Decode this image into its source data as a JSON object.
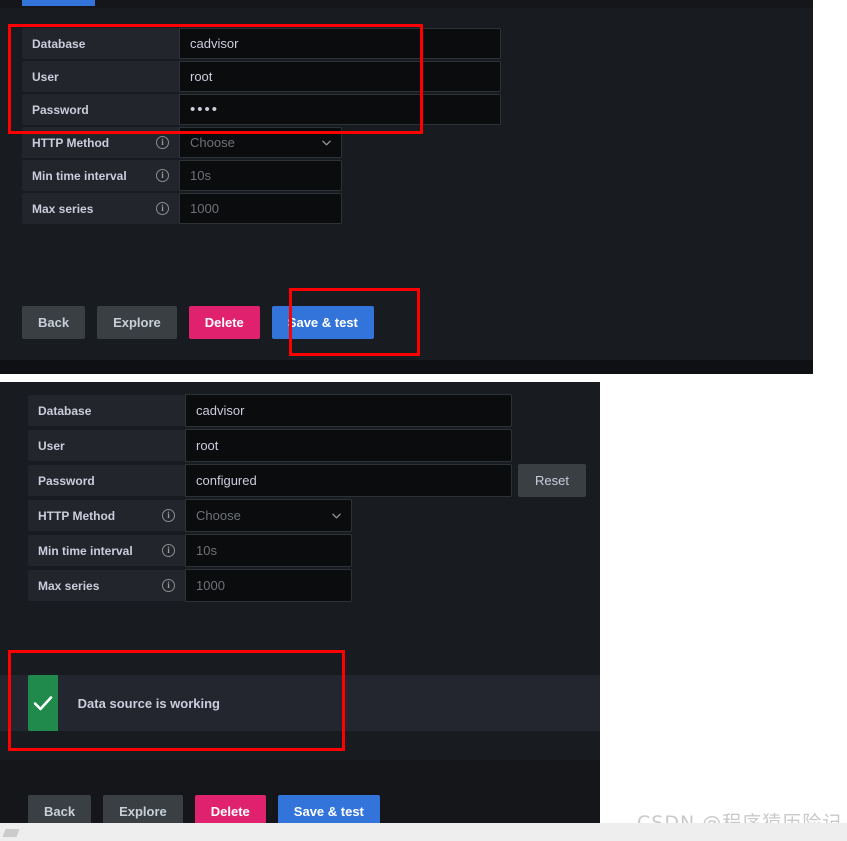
{
  "watermark": {
    "text": "CSDN @程序猿历险记"
  },
  "panel_top": {
    "tab": {
      "name": "active-tab-indicator"
    },
    "fields": [
      {
        "label": "Database",
        "value": "cadvisor",
        "placeholder": "",
        "type": "text",
        "has_info": false
      },
      {
        "label": "User",
        "value": "root",
        "placeholder": "",
        "type": "text",
        "has_info": false
      },
      {
        "label": "Password",
        "value": "••••",
        "placeholder": "",
        "type": "password",
        "has_info": false
      },
      {
        "label": "HTTP Method",
        "value": "",
        "placeholder": "Choose",
        "type": "select",
        "has_info": true
      },
      {
        "label": "Min time interval",
        "value": "",
        "placeholder": "10s",
        "type": "text",
        "has_info": true
      },
      {
        "label": "Max series",
        "value": "",
        "placeholder": "1000",
        "type": "text",
        "has_info": true
      }
    ],
    "buttons": [
      {
        "label": "Back",
        "style": "secondary"
      },
      {
        "label": "Explore",
        "style": "secondary"
      },
      {
        "label": "Delete",
        "style": "danger"
      },
      {
        "label": "Save & test",
        "style": "primary"
      }
    ]
  },
  "panel_bottom": {
    "fields": [
      {
        "label": "Database",
        "value": "cadvisor",
        "placeholder": "",
        "type": "text",
        "has_info": false,
        "reset": ""
      },
      {
        "label": "User",
        "value": "root",
        "placeholder": "",
        "type": "text",
        "has_info": false,
        "reset": ""
      },
      {
        "label": "Password",
        "value": "configured",
        "placeholder": "",
        "type": "text",
        "has_info": false,
        "reset": "Reset"
      },
      {
        "label": "HTTP Method",
        "value": "",
        "placeholder": "Choose",
        "type": "select",
        "has_info": true,
        "reset": ""
      },
      {
        "label": "Min time interval",
        "value": "",
        "placeholder": "10s",
        "type": "text",
        "has_info": true,
        "reset": ""
      },
      {
        "label": "Max series",
        "value": "",
        "placeholder": "1000",
        "type": "text",
        "has_info": true,
        "reset": ""
      }
    ],
    "alert": {
      "message": "Data source is working",
      "icon": "check-icon",
      "color": "#1f8a4c"
    },
    "buttons": [
      {
        "label": "Back",
        "style": "secondary"
      },
      {
        "label": "Explore",
        "style": "secondary"
      },
      {
        "label": "Delete",
        "style": "danger"
      },
      {
        "label": "Save & test",
        "style": "primary"
      }
    ]
  },
  "annotations": {
    "color": "#fe0000",
    "boxes": [
      {
        "name": "credentials-highlight"
      },
      {
        "name": "save-test-highlight"
      },
      {
        "name": "data-source-working-highlight"
      }
    ]
  }
}
